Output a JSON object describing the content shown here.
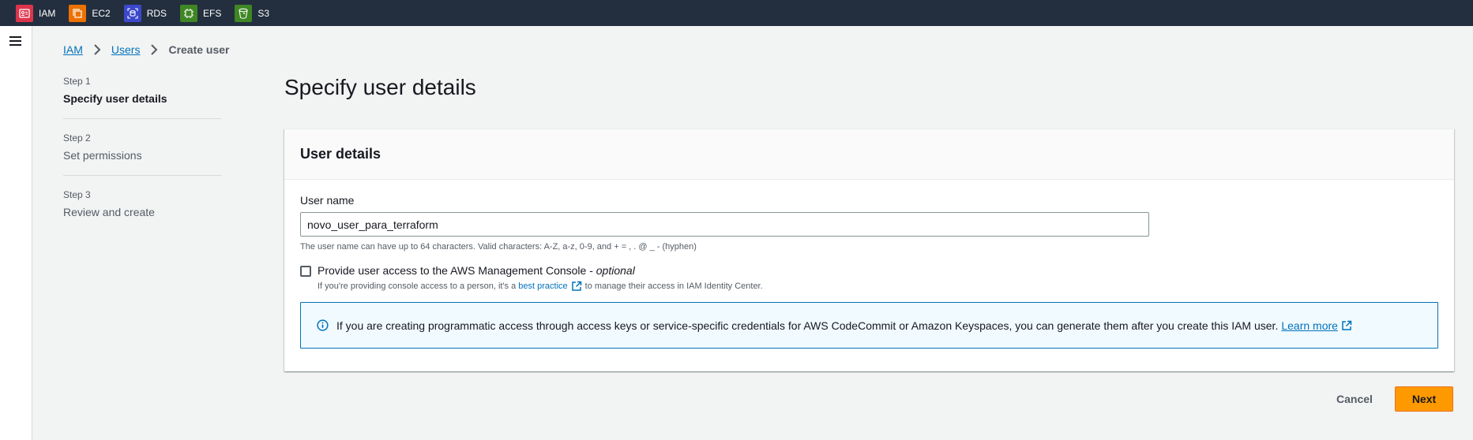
{
  "topbar": {
    "services": [
      {
        "label": "IAM",
        "icon": "iam-icon",
        "color": "#dd344c"
      },
      {
        "label": "EC2",
        "icon": "ec2-icon",
        "color": "#ed7100"
      },
      {
        "label": "RDS",
        "icon": "rds-icon",
        "color": "#3b48cc"
      },
      {
        "label": "EFS",
        "icon": "efs-icon",
        "color": "#3f8624"
      },
      {
        "label": "S3",
        "icon": "s3-icon",
        "color": "#3f8624"
      }
    ]
  },
  "breadcrumb": {
    "items": [
      {
        "label": "IAM"
      },
      {
        "label": "Users"
      },
      {
        "label": "Create user"
      }
    ]
  },
  "steps": [
    {
      "number": "Step 1",
      "title": "Specify user details",
      "active": true
    },
    {
      "number": "Step 2",
      "title": "Set permissions",
      "active": false
    },
    {
      "number": "Step 3",
      "title": "Review and create",
      "active": false
    }
  ],
  "page": {
    "title": "Specify user details"
  },
  "card": {
    "title": "User details",
    "username_label": "User name",
    "username_value": "novo_user_para_terraform",
    "username_hint": "The user name can have up to 64 characters. Valid characters: A-Z, a-z, 0-9, and + = , . @ _ - (hyphen)",
    "console_access_label": "Provide user access to the AWS Management Console -",
    "console_access_optional": "optional",
    "console_access_checked": false,
    "console_desc_before": "If you're providing console access to a person, it's a",
    "console_desc_link": "best practice",
    "console_desc_after": "to manage their access in IAM Identity Center.",
    "info_text": "If you are creating programmatic access through access keys or service-specific credentials for AWS CodeCommit or Amazon Keyspaces, you can generate them after you create this IAM user.",
    "info_link": "Learn more"
  },
  "actions": {
    "cancel_label": "Cancel",
    "next_label": "Next"
  },
  "colors": {
    "topbar_bg": "#232f3e",
    "link": "#0073bb",
    "primary_button": "#ff9900",
    "info_border": "#0073bb",
    "info_bg": "#f1faff"
  }
}
